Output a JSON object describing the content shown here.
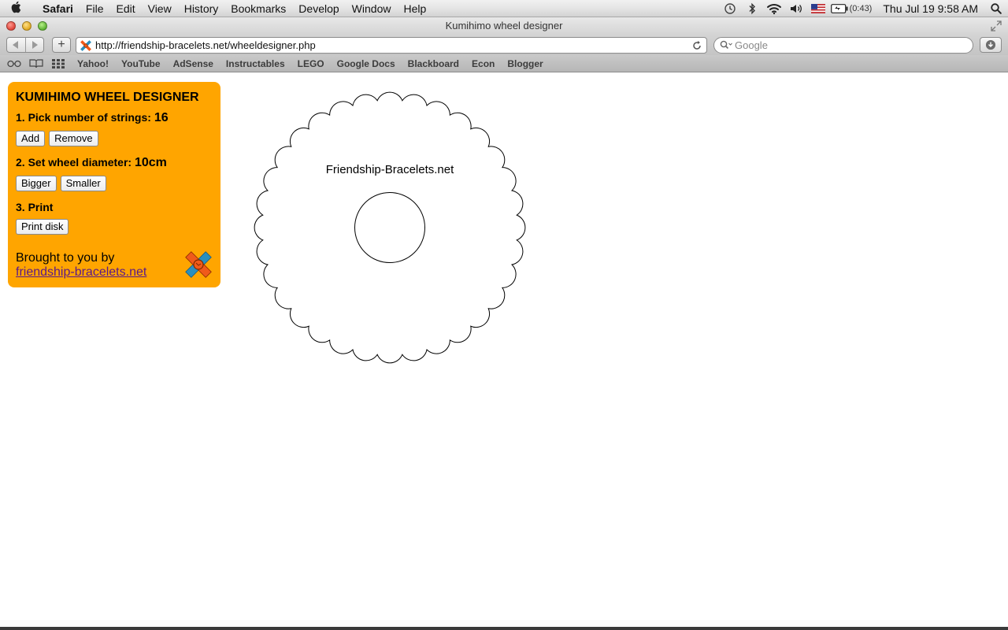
{
  "menubar": {
    "app_name": "Safari",
    "items": [
      "File",
      "Edit",
      "View",
      "History",
      "Bookmarks",
      "Develop",
      "Window",
      "Help"
    ],
    "battery_time": "(0:43)",
    "clock": "Thu Jul 19  9:58 AM"
  },
  "window": {
    "title": "Kumihimo wheel designer"
  },
  "toolbar": {
    "url": "http://friendship-bracelets.net/wheeldesigner.php",
    "search_placeholder": "Google"
  },
  "bookmarks": [
    "Yahoo!",
    "YouTube",
    "AdSense",
    "Instructables",
    "LEGO",
    "Google Docs",
    "Blackboard",
    "Econ",
    "Blogger"
  ],
  "panel": {
    "title": "KUMIHIMO WHEEL DESIGNER",
    "step1_label": "1. Pick number of strings:",
    "step1_value": "16",
    "add_label": "Add",
    "remove_label": "Remove",
    "step2_label": "2. Set wheel diameter:",
    "step2_value": "10cm",
    "bigger_label": "Bigger",
    "smaller_label": "Smaller",
    "step3_label": "3. Print",
    "print_label": "Print disk",
    "credit_text": "Brought to you by",
    "credit_link": "friendship-bracelets.net"
  },
  "wheel": {
    "label": "Friendship-Bracelets.net",
    "scallops": 32
  },
  "colors": {
    "panel_bg": "#ffa500",
    "link": "#5a1a8a"
  }
}
